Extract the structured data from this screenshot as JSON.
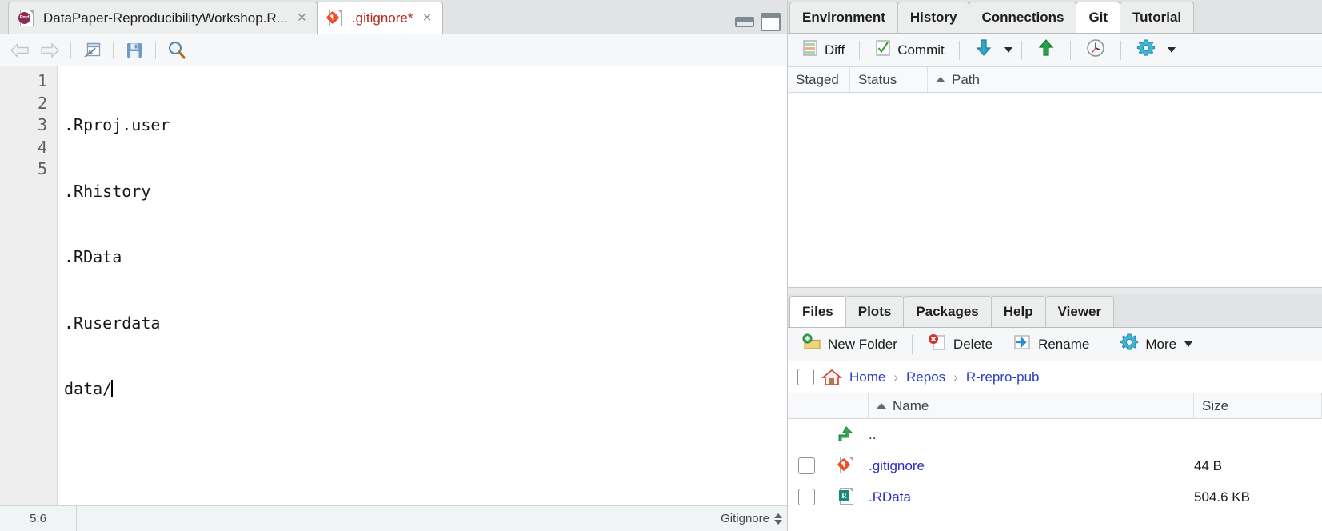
{
  "editor": {
    "tabs": [
      {
        "label": "DataPaper-ReproducibilityWorkshop.R...",
        "icon": "rmd-file-icon",
        "active": false,
        "close": "×"
      },
      {
        "label": ".gitignore*",
        "icon": "git-file-icon",
        "active": true,
        "close": "×"
      }
    ],
    "toolbar": [
      {
        "name": "back-button",
        "icon": "back-arrow-icon"
      },
      {
        "name": "forward-button",
        "icon": "forward-arrow-icon"
      },
      {
        "name": "popout-button",
        "icon": "popout-window-icon"
      },
      {
        "name": "save-button",
        "icon": "save-disk-icon"
      },
      {
        "name": "find-button",
        "icon": "magnifier-icon"
      }
    ],
    "window_controls": {
      "minimize": "minimize-icon",
      "maximize": "maximize-icon"
    },
    "gutter": [
      "1",
      "2",
      "3",
      "4",
      "5"
    ],
    "lines": [
      ".Rproj.user",
      ".Rhistory",
      ".RData",
      ".Ruserdata",
      "data/"
    ],
    "status": {
      "cursor_position": "5:6",
      "file_type": "Gitignore"
    }
  },
  "git": {
    "tabs": [
      {
        "label": "Environment",
        "active": false
      },
      {
        "label": "History",
        "active": false
      },
      {
        "label": "Connections",
        "active": false
      },
      {
        "label": "Git",
        "active": true
      },
      {
        "label": "Tutorial",
        "active": false
      }
    ],
    "toolbar": [
      {
        "name": "diff-button",
        "label": "Diff",
        "icon": "diff-icon"
      },
      {
        "name": "commit-button",
        "label": "Commit",
        "icon": "checkbox-checked-icon"
      },
      {
        "name": "pull-button",
        "label": "",
        "icon": "pull-down-arrow-icon"
      },
      {
        "name": "push-button",
        "label": "",
        "icon": "push-up-arrow-icon"
      },
      {
        "name": "history-button",
        "label": "",
        "icon": "clock-icon"
      },
      {
        "name": "more-gear-button",
        "label": "",
        "icon": "gear-icon"
      }
    ],
    "columns": [
      {
        "label": "Staged",
        "sorted": false
      },
      {
        "label": "Status",
        "sorted": false
      },
      {
        "label": "Path",
        "sorted": true
      }
    ],
    "rows": []
  },
  "files": {
    "tabs": [
      {
        "label": "Files",
        "active": true
      },
      {
        "label": "Plots",
        "active": false
      },
      {
        "label": "Packages",
        "active": false
      },
      {
        "label": "Help",
        "active": false
      },
      {
        "label": "Viewer",
        "active": false
      }
    ],
    "toolbar": [
      {
        "name": "new-folder-button",
        "label": "New Folder",
        "icon": "new-folder-icon"
      },
      {
        "name": "delete-button",
        "label": "Delete",
        "icon": "delete-icon"
      },
      {
        "name": "rename-button",
        "label": "Rename",
        "icon": "rename-icon"
      },
      {
        "name": "more-button",
        "label": "More",
        "icon": "gear-icon"
      }
    ],
    "breadcrumb": {
      "home_icon": "home-icon",
      "separator": "›",
      "items": [
        "Home",
        "Repos",
        "R-repro-pub"
      ]
    },
    "columns": [
      {
        "label": "Name",
        "sorted": true
      },
      {
        "label": "Size",
        "sorted": false
      }
    ],
    "rows": [
      {
        "name": "..",
        "size": "",
        "icon": "up-folder-arrow-icon",
        "has_checkbox": false,
        "link": false
      },
      {
        "name": ".gitignore",
        "size": "44 B",
        "icon": "git-file-icon",
        "has_checkbox": true,
        "link": true
      },
      {
        "name": ".RData",
        "size": "504.6 KB",
        "icon": "rdata-file-icon",
        "has_checkbox": true,
        "link": true
      }
    ]
  },
  "colors": {
    "link": "#2b2bbf",
    "git_orange": "#f04e23",
    "rmd_magenta": "#8e2b54",
    "push_green": "#23a24b",
    "pull_blue": "#2fa8c9",
    "rdata_teal": "#1a8a78",
    "tab_active_bg": "#ffffff",
    "panel_bg": "#f5f7f8"
  }
}
